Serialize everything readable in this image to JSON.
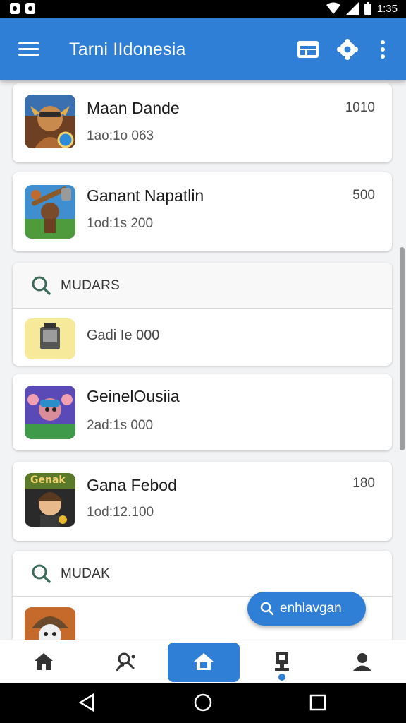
{
  "status_bar": {
    "time": "1:35"
  },
  "app_bar": {
    "title": "Tarni IIdonesia"
  },
  "list": {
    "items": [
      {
        "title": "Maan Dande",
        "subtitle": "1ao:1o 063",
        "score": "1010",
        "icon": "game-thumb-warrior"
      },
      {
        "title": "Ganant Napatlin",
        "subtitle": "1od:1s 200",
        "score": "500",
        "icon": "game-thumb-hammer"
      },
      {
        "section_label": "MUDARS",
        "icon": "search-icon"
      },
      {
        "subtitle": "Gadi Ie 000",
        "icon": "game-thumb-device"
      },
      {
        "title": "GeinelOusiia",
        "subtitle": "2ad:1s 000",
        "icon": "game-thumb-creature"
      },
      {
        "title": "Gana Febod",
        "subtitle": "1od:12.100",
        "score": "180",
        "icon": "game-thumb-kid",
        "badge": "Genak"
      },
      {
        "section_label": "MUDAK",
        "icon": "search-icon"
      },
      {
        "icon": "game-thumb-hat"
      }
    ]
  },
  "fab": {
    "label": "enhlavgan",
    "icon": "search-icon"
  },
  "bottom_nav": {
    "items": [
      {
        "icon": "house-icon"
      },
      {
        "icon": "person-search-icon"
      },
      {
        "icon": "home-icon",
        "active": true
      },
      {
        "icon": "trophy-icon"
      },
      {
        "icon": "profile-icon"
      }
    ]
  },
  "colors": {
    "accent": "#2f7fd6",
    "background": "#f2f3f5",
    "card": "#ffffff"
  }
}
